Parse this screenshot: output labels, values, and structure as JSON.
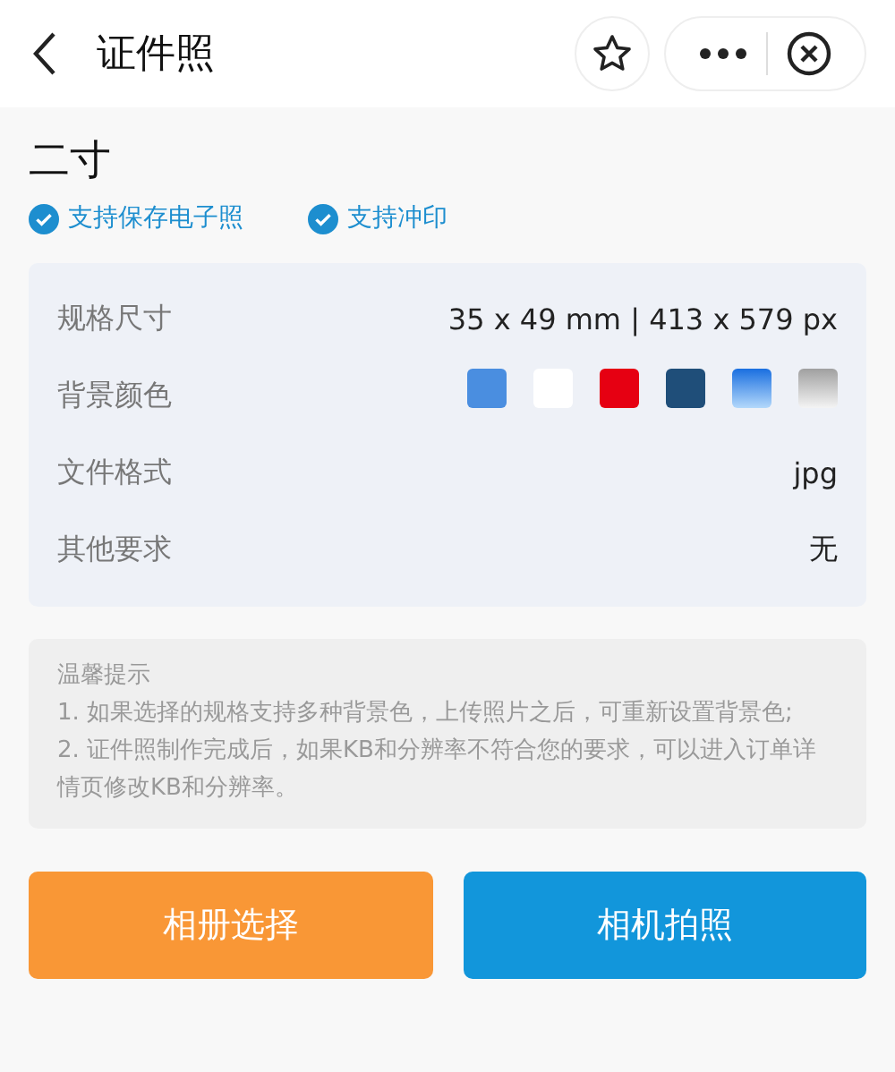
{
  "header": {
    "title": "证件照"
  },
  "spec": {
    "name": "二寸",
    "features": [
      {
        "label": "支持保存电子照",
        "checked": true
      },
      {
        "label": "支持冲印",
        "checked": true
      }
    ]
  },
  "details": [
    {
      "kind": "text",
      "label": "规格尺寸",
      "value": "35 x 49 mm | 413 x 579 px"
    },
    {
      "kind": "colors",
      "label": "背景颜色",
      "swatches": [
        {
          "kind": "solid",
          "color": "#4a8ee0"
        },
        {
          "kind": "solid",
          "color": "#ffffff"
        },
        {
          "kind": "solid",
          "color": "#e60012"
        },
        {
          "kind": "solid",
          "color": "#1f4e79"
        },
        {
          "kind": "bluefade"
        },
        {
          "kind": "greyfade"
        }
      ]
    },
    {
      "kind": "text",
      "label": "文件格式",
      "value": "jpg"
    },
    {
      "kind": "text",
      "label": "其他要求",
      "value": "无"
    }
  ],
  "tips": {
    "title": "温馨提示",
    "items": [
      "1. 如果选择的规格支持多种背景色，上传照片之后，可重新设置背景色;",
      "2. 证件照制作完成后，如果KB和分辨率不符合您的要求，可以进入订单详情页修改KB和分辨率。"
    ]
  },
  "buttons": [
    {
      "label": "相册选择",
      "color": "#f99736"
    },
    {
      "label": "相机拍照",
      "color": "#1296db"
    }
  ]
}
